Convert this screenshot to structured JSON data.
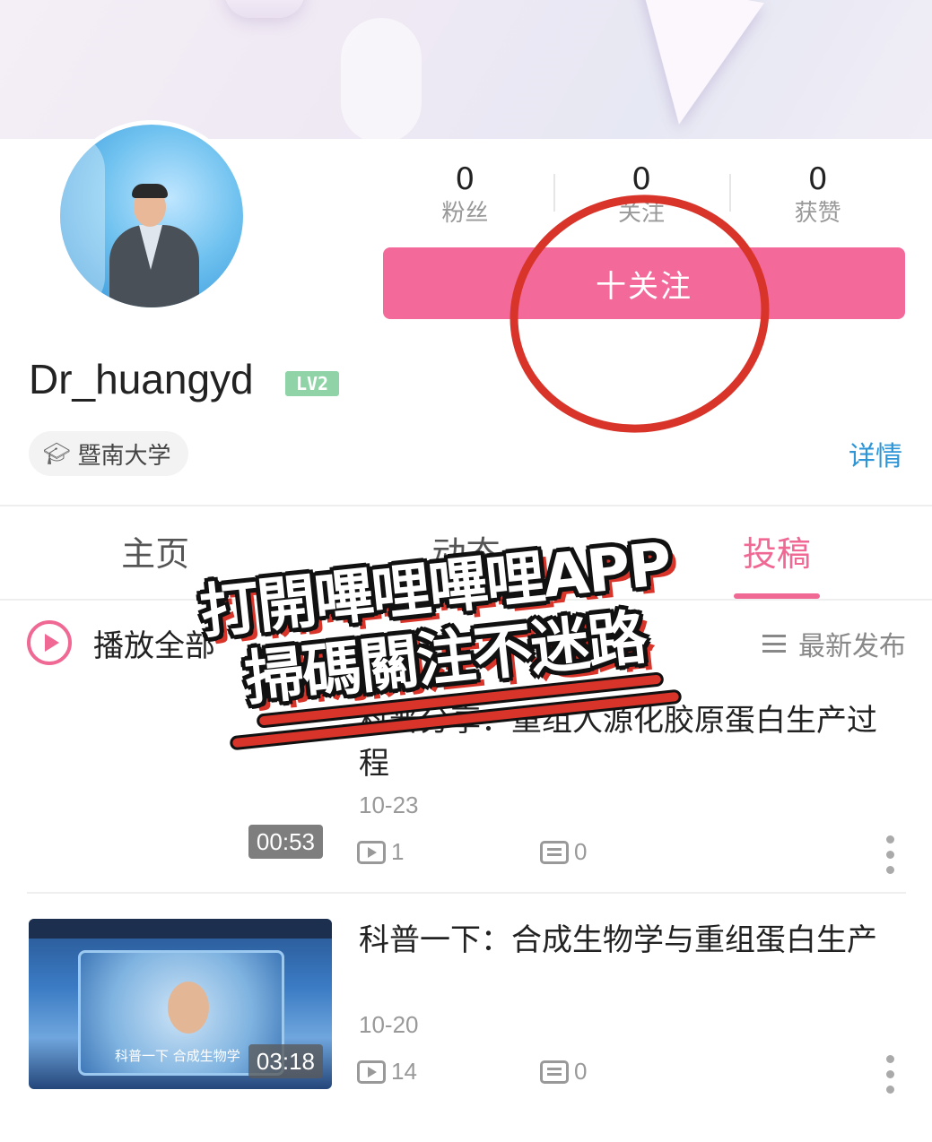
{
  "profile": {
    "username": "Dr_huangyd",
    "level": "LV2",
    "school": "暨南大学",
    "details_label": "详情",
    "follow_label": "十关注",
    "stats": [
      {
        "value": "0",
        "label": "粉丝"
      },
      {
        "value": "0",
        "label": "关注"
      },
      {
        "value": "0",
        "label": "获赞"
      }
    ]
  },
  "tabs": [
    {
      "label": "主页",
      "active": false
    },
    {
      "label": "动态",
      "active": false
    },
    {
      "label": "投稿",
      "active": true
    }
  ],
  "list_header": {
    "play_all": "播放全部",
    "sort_label": "最新发布"
  },
  "videos": [
    {
      "title": "科普分享：重组人源化胶原蛋白生产过程",
      "date": "10-23",
      "duration": "00:53",
      "plays": "1",
      "comments": "0"
    },
    {
      "title": "科普一下：合成生物学与重组蛋白生产",
      "date": "10-20",
      "duration": "03:18",
      "plays": "14",
      "comments": "0",
      "thumb_caption": "科普一下  合成生物学"
    }
  ],
  "overlay": {
    "line1": "打開嗶哩嗶哩APP",
    "line2": "掃碼關注不迷路"
  },
  "colors": {
    "accent_pink": "#f06994",
    "follow_button": "#f3699a",
    "link_blue": "#2e95d6",
    "annotation_red": "#d8342a",
    "level_green": "#8fd3a6"
  }
}
